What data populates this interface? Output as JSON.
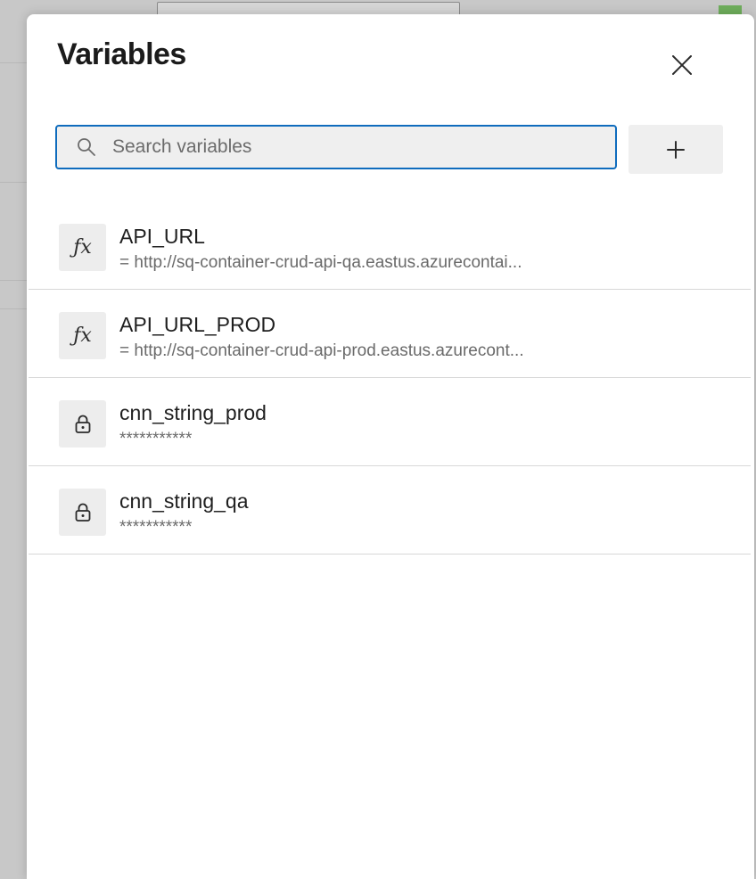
{
  "dialog": {
    "title": "Variables"
  },
  "search": {
    "placeholder": "Search variables",
    "value": ""
  },
  "variables": [
    {
      "name": "API_URL",
      "value": "= http://sq-container-crud-api-qa.eastus.azurecontai...",
      "icon": "fx-icon",
      "secret": false
    },
    {
      "name": "API_URL_PROD",
      "value": "= http://sq-container-crud-api-prod.eastus.azurecont...",
      "icon": "fx-icon",
      "secret": false
    },
    {
      "name": "cnn_string_prod",
      "value": "***********",
      "icon": "lock-icon",
      "secret": true
    },
    {
      "name": "cnn_string_qa",
      "value": "***********",
      "icon": "lock-icon",
      "secret": true
    }
  ],
  "colors": {
    "accent": "#0f6cbd",
    "backdrop": "#c8c8c8"
  }
}
